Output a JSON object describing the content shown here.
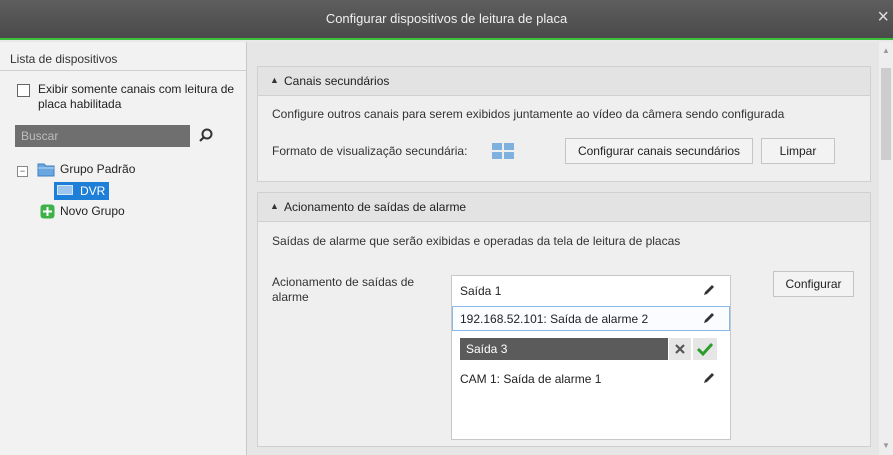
{
  "window": {
    "title": "Configurar dispositivos de leitura de placa",
    "close_label": "×"
  },
  "left_panel": {
    "header": "Lista de dispositivos",
    "checkbox_label": "Exibir somente canais com leitura de placa habilitada",
    "search_placeholder": "Buscar",
    "tree": {
      "group_label": "Grupo Padrão",
      "device_label": "DVR",
      "new_group_label": "Novo Grupo"
    }
  },
  "secondary_channels": {
    "title": "Canais secundários",
    "description": "Configure outros canais para serem exibidos juntamente ao vídeo da câmera sendo configurada",
    "format_label": "Formato de visualização secundária:",
    "configure_button": "Configurar canais secundários",
    "clear_button": "Limpar"
  },
  "alarm_outputs": {
    "title": "Acionamento de saídas de alarme",
    "description": "Saídas de alarme que serão exibidas e operadas da tela de leitura de placas",
    "field_label": "Acionamento de saídas de alarme",
    "configure_button": "Configurar",
    "items": [
      {
        "label": "Saída 1"
      },
      {
        "label": "192.168.52.101: Saída de alarme 2"
      },
      {
        "label": "Saída 3"
      },
      {
        "label": "CAM 1: Saída de alarme 1"
      }
    ]
  },
  "colors": {
    "accent_green": "#3ec03e",
    "selection_blue": "#1e7fd8"
  }
}
